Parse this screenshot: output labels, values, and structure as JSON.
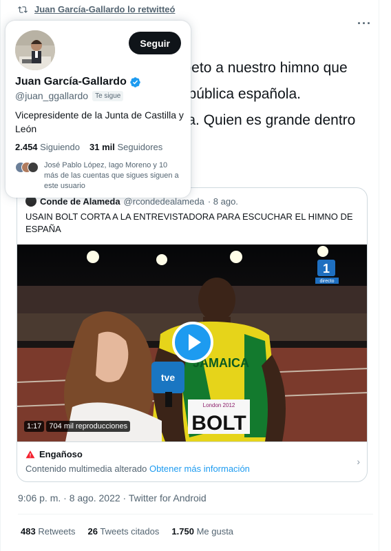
{
  "retweet": {
    "label": "Juan García-Gallardo lo retwitteó"
  },
  "tweet": {
    "text_lines": [
      "speto a nuestro himno que",
      "n pública española.",
      "sta. Quien es grande dentro"
    ],
    "timestamp": "9:06 p. m. · 8 ago. 2022 · Twitter for Android",
    "stats": {
      "retweets_count": "483",
      "retweets_label": "Retweets",
      "quotes_count": "26",
      "quotes_label": "Tweets citados",
      "likes_count": "1.750",
      "likes_label": "Me gusta"
    }
  },
  "hover_card": {
    "follow_label": "Seguir",
    "name": "Juan García-Gallardo",
    "handle": "@juan_ggallardo",
    "follows_you_badge": "Te sigue",
    "bio": "Vicepresidente de la Junta de Castilla y León",
    "following_count": "2.454",
    "following_label": "Siguiendo",
    "followers_count": "31 mil",
    "followers_label": "Seguidores",
    "mutual_text": "José Pablo López, Iago Moreno y 10 más de las cuentas que sigues siguen a este usuario"
  },
  "quote": {
    "author_name": "Conde de Alameda",
    "author_handle": "@rcondedealameda",
    "date": "· 8 ago.",
    "text": "USAIN BOLT CORTA A LA ENTREVISTADORA PARA ESCUCHAR EL HIMNO DE ESPAÑA",
    "video": {
      "duration": "1:17",
      "views": "704 mil reproducciones",
      "bib_name": "BOLT",
      "shirt_text": "JAMAICA",
      "mic_logo": "tve",
      "event": "London 2012",
      "channel": "1",
      "channel_sub": "directo"
    },
    "warning": {
      "title": "Engañoso",
      "body": "Contenido multimedia alterado",
      "link": "Obtener más información"
    }
  },
  "colors": {
    "accent": "#1d9bf0",
    "warning": "#f4212e",
    "text": "#0f1419",
    "muted": "#536471"
  }
}
